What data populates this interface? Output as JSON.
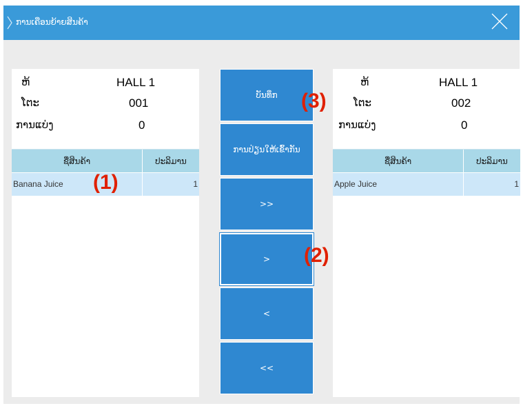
{
  "window": {
    "title": "ການເຄືອນຍ້າຍສິນຄ້າ",
    "title_chevron": "chevron-right-icon",
    "close_icon": "close-icon",
    "accent": "#3a9ad9"
  },
  "left_panel": {
    "zone_label": "ຫ້",
    "zone_value": "HALL 1",
    "table_label": "ໂຕະ",
    "table_value": "001",
    "split_label": "ການແບ່ງ",
    "split_value": "0",
    "columns": [
      "ຊື່ສິນຄ້າ",
      "ປະລິມານ"
    ],
    "rows": [
      {
        "name": "Banana Juice",
        "qty": "1"
      }
    ]
  },
  "right_panel": {
    "zone_label": "ຫ້",
    "zone_value": "HALL 1",
    "table_label": "ໂຕະ",
    "table_value": "002",
    "split_label": "ການແບ່ງ",
    "split_value": "0",
    "columns": [
      "ຊື່ສິນຄ້າ",
      "ປະລິມານ"
    ],
    "rows": [
      {
        "name": "Apple Juice",
        "qty": "1"
      }
    ]
  },
  "buttons": {
    "save": "ບັນທຶກ",
    "merge": "ການປ່ຽນໃຫ້ເຂົ້າກັນ",
    "move_all_right": ">>",
    "move_right": ">",
    "move_left": "<",
    "move_all_left": "<<"
  },
  "annotations": {
    "a1": "(1)",
    "a2": "(2)",
    "a3": "(3)"
  }
}
